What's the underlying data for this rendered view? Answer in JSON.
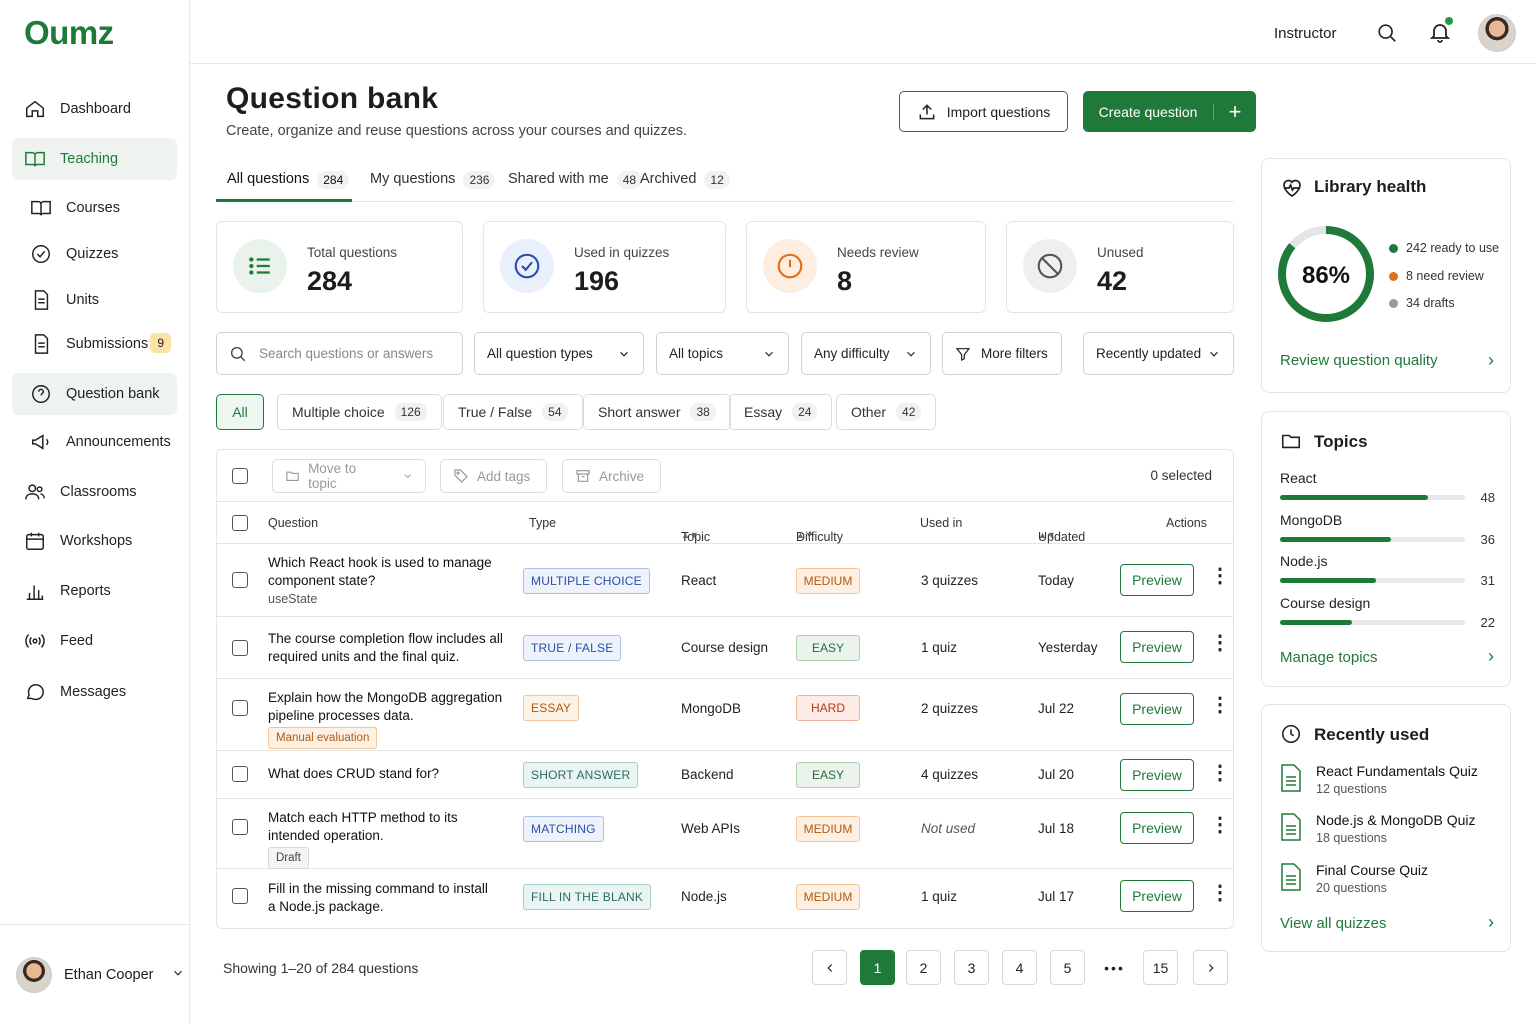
{
  "brand": {
    "logo": "Oumz",
    "accent": "#1f7a3a"
  },
  "sidebar": {
    "items": [
      {
        "label": "Dashboard",
        "icon": "home-icon"
      },
      {
        "label": "Teaching",
        "icon": "book-icon"
      },
      {
        "label": "Courses",
        "icon": "book-icon"
      },
      {
        "label": "Quizzes",
        "icon": "check-circle-icon"
      },
      {
        "label": "Units",
        "icon": "document-icon"
      },
      {
        "label": "Submissions",
        "icon": "document-icon",
        "badge": "9"
      },
      {
        "label": "Question bank",
        "icon": "help-circle-icon"
      },
      {
        "label": "Announcements",
        "icon": "megaphone-icon"
      },
      {
        "label": "Classrooms",
        "icon": "users-icon"
      },
      {
        "label": "Workshops",
        "icon": "calendar-icon"
      },
      {
        "label": "Reports",
        "icon": "bar-chart-icon"
      },
      {
        "label": "Feed",
        "icon": "broadcast-icon"
      },
      {
        "label": "Messages",
        "icon": "chat-icon"
      }
    ],
    "user": {
      "name": "Ethan Cooper"
    }
  },
  "topbar": {
    "role": "Instructor"
  },
  "page": {
    "title": "Question bank",
    "subtitle": "Create, organize and reuse questions across your courses and quizzes.",
    "import_label": "Import questions",
    "create_label": "Create question",
    "create_plus": "+"
  },
  "tabs": [
    {
      "label": "All questions",
      "count": "284"
    },
    {
      "label": "My questions",
      "count": "236"
    },
    {
      "label": "Shared with me",
      "count": "48"
    },
    {
      "label": "Archived",
      "count": "12"
    }
  ],
  "stats": [
    {
      "label": "Total questions",
      "value": "284"
    },
    {
      "label": "Used in quizzes",
      "value": "196"
    },
    {
      "label": "Needs review",
      "value": "8"
    },
    {
      "label": "Unused",
      "value": "42"
    }
  ],
  "filters": {
    "search_placeholder": "Search questions or answers",
    "type": "All question types",
    "topic": "All topics",
    "difficulty": "Any difficulty",
    "more": "More filters",
    "sort": "Recently updated"
  },
  "chips": [
    {
      "label": "All"
    },
    {
      "label": "Multiple choice",
      "count": "126"
    },
    {
      "label": "True / False",
      "count": "54"
    },
    {
      "label": "Short answer",
      "count": "38"
    },
    {
      "label": "Essay",
      "count": "24"
    },
    {
      "label": "Other",
      "count": "42"
    }
  ],
  "bulk": {
    "move": "Move to topic",
    "tags": "Add tags",
    "archive": "Archive",
    "selected": "0 selected"
  },
  "columns": {
    "question": "Question",
    "type": "Type",
    "topic": "Topic",
    "difficulty": "Difficulty",
    "used": "Used in",
    "updated": "Updated",
    "actions": "Actions"
  },
  "rows": [
    {
      "q1": "Which React hook is used to manage",
      "q2": "component state?",
      "sub": "useState",
      "type": "MULTIPLE CHOICE",
      "topic": "React",
      "difficulty": "MEDIUM",
      "used": "3 quizzes",
      "updated": "Today",
      "action": "Preview"
    },
    {
      "q1": "The course completion flow includes all",
      "q2": "required units and the final quiz.",
      "type": "TRUE / FALSE",
      "topic": "Course design",
      "difficulty": "EASY",
      "used": "1 quiz",
      "updated": "Yesterday",
      "action": "Preview"
    },
    {
      "q1": "Explain how the MongoDB aggregation",
      "q2": "pipeline processes data.",
      "tag": "Manual evaluation",
      "type": "ESSAY",
      "topic": "MongoDB",
      "difficulty": "HARD",
      "used": "2 quizzes",
      "updated": "Jul 22",
      "action": "Preview"
    },
    {
      "q1": "What does CRUD stand for?",
      "type": "SHORT ANSWER",
      "topic": "Backend",
      "difficulty": "EASY",
      "used": "4 quizzes",
      "updated": "Jul 20",
      "action": "Preview"
    },
    {
      "q1": "Match each HTTP method to its",
      "q2": "intended operation.",
      "tag": "Draft",
      "type": "MATCHING",
      "topic": "Web APIs",
      "difficulty": "MEDIUM",
      "used": "Not used",
      "updated": "Jul 18",
      "action": "Preview"
    },
    {
      "q1": "Fill in the missing command to install",
      "q2": "a Node.js package.",
      "type": "FILL IN THE BLANK",
      "topic": "Node.js",
      "difficulty": "MEDIUM",
      "used": "1 quiz",
      "updated": "Jul 17",
      "action": "Preview"
    }
  ],
  "pagination": {
    "showing": "Showing 1–20 of 284 questions",
    "pages": [
      "1",
      "2",
      "3",
      "4",
      "5",
      "•••",
      "15"
    ],
    "current": "1"
  },
  "health": {
    "title": "Library health",
    "percent": "86%",
    "ready_fraction": 0.86,
    "legend": [
      "242 ready to use",
      "8 need review",
      "34 drafts"
    ],
    "link": "Review question quality"
  },
  "topics": {
    "title": "Topics",
    "items": [
      {
        "name": "React",
        "count": "48",
        "fraction": 0.8
      },
      {
        "name": "MongoDB",
        "count": "36",
        "fraction": 0.6
      },
      {
        "name": "Node.js",
        "count": "31",
        "fraction": 0.52
      },
      {
        "name": "Course design",
        "count": "22",
        "fraction": 0.39
      }
    ],
    "link": "Manage topics"
  },
  "recent": {
    "title": "Recently used",
    "items": [
      {
        "name": "React Fundamentals Quiz",
        "sub": "12 questions"
      },
      {
        "name": "Node.js & MongoDB Quiz",
        "sub": "18 questions"
      },
      {
        "name": "Final Course Quiz",
        "sub": "20 questions"
      }
    ],
    "link": "View all quizzes"
  }
}
